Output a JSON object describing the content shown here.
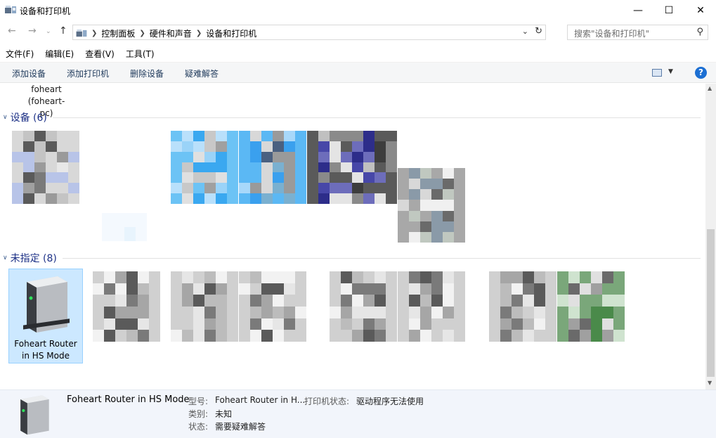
{
  "window": {
    "title": "设备和打印机"
  },
  "address": {
    "crumbs": [
      "控制面板",
      "硬件和声音",
      "设备和打印机"
    ],
    "search_placeholder": "搜索\"设备和打印机\""
  },
  "menu": [
    "文件(F)",
    "编辑(E)",
    "查看(V)",
    "工具(T)"
  ],
  "toolbar": {
    "add_device": "添加设备",
    "add_printer": "添加打印机",
    "remove_device": "删除设备",
    "troubleshoot": "疑难解答",
    "help": "?"
  },
  "computer": {
    "name": "foheart",
    "host": "(foheart-pc)"
  },
  "groups": {
    "devices": {
      "title": "设备 (6)"
    },
    "unspecified": {
      "title": "未指定 (8)"
    }
  },
  "selected_item": {
    "label": "Foheart Router in HS Mode"
  },
  "details": {
    "name": "Foheart Router in HS Mode",
    "model_label": "型号:",
    "model_value": "Foheart Router in H...",
    "printer_status_label": "打印机状态:",
    "printer_status_value": "驱动程序无法使用",
    "category_label": "类别:",
    "category_value": "未知",
    "status_label": "状态:",
    "status_value": "需要疑难解答"
  },
  "colors": {
    "accent": "#1e3287",
    "selection": "#cce8ff",
    "help": "#1c6fd3"
  },
  "icons": [
    "folder-printer-icon",
    "back-arrow-icon",
    "forward-arrow-icon",
    "up-arrow-icon",
    "search-icon",
    "refresh-icon",
    "help-icon",
    "router-icon"
  ]
}
